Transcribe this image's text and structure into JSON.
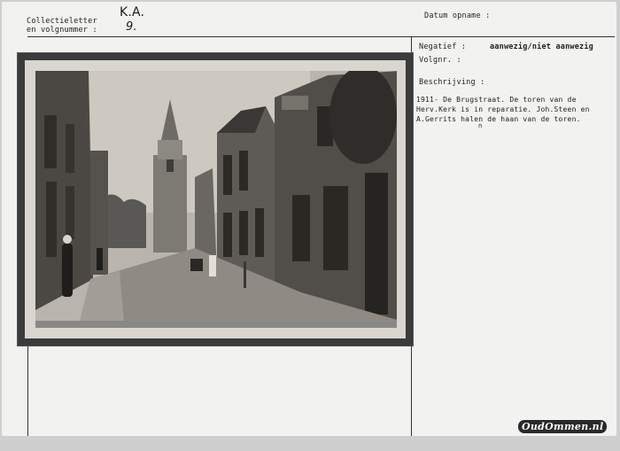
{
  "form": {
    "collectie_label_1": "Collectieletter",
    "collectie_label_2": "en volgnummer  :",
    "collectie_letter": "K.A.",
    "volgnummer": "9.",
    "datum_label": "Datum opname :",
    "negatief_label": "Negatief  :",
    "negatief_value": "aanwezig/niet aanwezig",
    "volgnr_label": "Volgnr.     :",
    "beschrijving_label": "Beschrijving :"
  },
  "description": {
    "line1": "1911- De Brugstraat. De toren van de",
    "line2": "Herv.Kerk is in reparatie. Joh.Steen en",
    "line3": "A.Gerrits halen de haan van de toren.",
    "correction_mark": "n"
  },
  "photo": {
    "subject": "street-photograph"
  },
  "watermark": {
    "text": "OudOmmen.nl"
  }
}
